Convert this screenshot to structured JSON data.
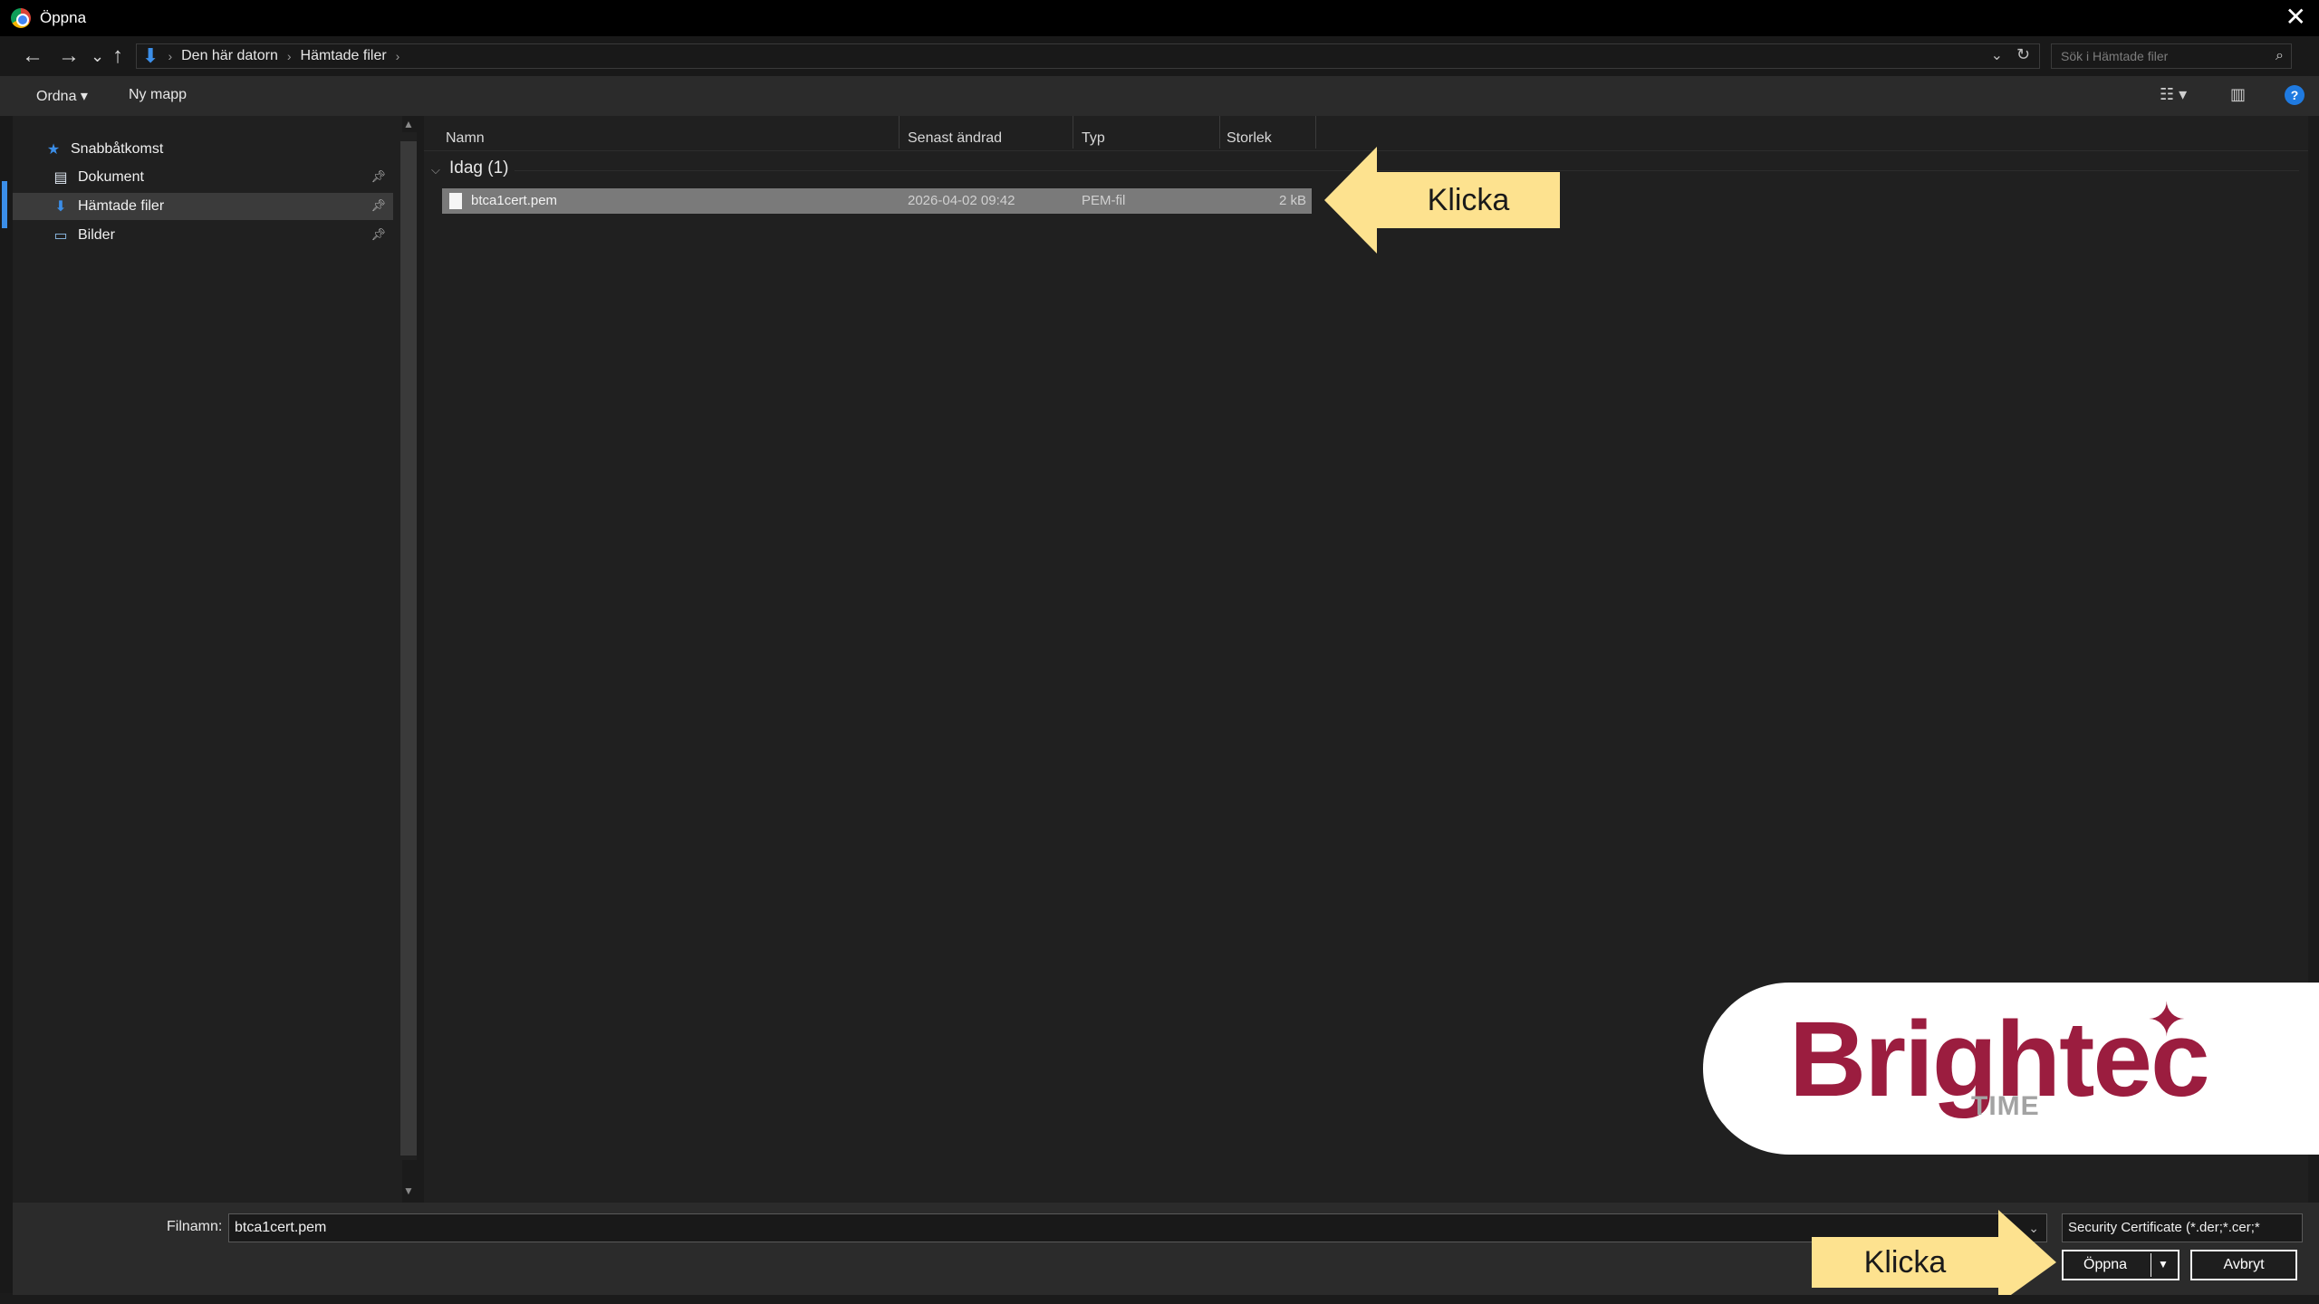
{
  "window": {
    "title": "Öppna",
    "close": "✕"
  },
  "nav": {
    "back": "←",
    "forward": "→",
    "recent": "⌄",
    "up": "↑"
  },
  "address": {
    "crumbs": [
      "Den här datorn",
      "Hämtade filer"
    ],
    "separator": "›",
    "search_placeholder": "Sök i Hämtade filer"
  },
  "toolbar": {
    "organize": "Ordna ▾",
    "new_folder": "Ny mapp"
  },
  "sidebar": {
    "items": [
      {
        "label": "Snabbåtkomst",
        "icon": "star-icon"
      },
      {
        "label": "Dokument",
        "icon": "document-icon"
      },
      {
        "label": "Hämtade filer",
        "icon": "download-icon"
      },
      {
        "label": "Bilder",
        "icon": "pictures-icon"
      }
    ]
  },
  "columns": {
    "name": "Namn",
    "modified": "Senast ändrad",
    "type": "Typ",
    "size": "Storlek"
  },
  "group": {
    "title": "Idag (1)"
  },
  "files": [
    {
      "name": "btca1cert.pem",
      "modified": "2026-04-02 09:42",
      "type": "PEM-fil",
      "size": "2 kB"
    }
  ],
  "footer": {
    "filename_label": "Filnamn:",
    "filename_value": "btca1cert.pem",
    "filter": "Security Certificate (*.der;*.cer;*",
    "open_label": "Öppna",
    "cancel_label": "Avbryt"
  },
  "callouts": {
    "file_hint": "Klicka",
    "open_hint": "Klicka",
    "color": "#fde28f"
  },
  "brand": {
    "name": "Brightec",
    "sub": "TIME",
    "color": "#9b1d3f"
  }
}
